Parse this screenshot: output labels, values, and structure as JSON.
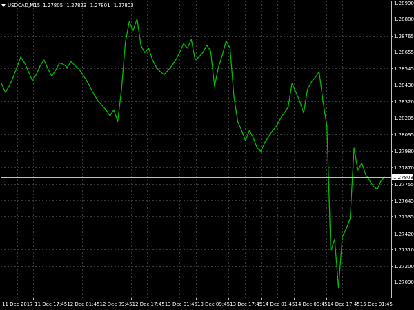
{
  "header": {
    "symbol": "USDCAD,M15",
    "ohlc": [
      "1.27805",
      "1.27823",
      "1.27801",
      "1.27803"
    ]
  },
  "current_price_label": "1.27803",
  "colors": {
    "background": "#000000",
    "grid": "#3a3a3a",
    "frame": "#c0c0c0",
    "series": "#00c000",
    "text": "#ffffff",
    "bid_line": "#c0c0c0",
    "price_tag_bg": "#ffffff",
    "price_tag_text": "#000000"
  },
  "chart_data": {
    "type": "line",
    "title": "USDCAD,M15",
    "xlabel": "",
    "ylabel": "",
    "ylim": [
      1.26983,
      1.29003
    ],
    "grid": true,
    "y_ticks": [
      "1.28990",
      "1.28880",
      "1.28765",
      "1.28655",
      "1.28545",
      "1.28430",
      "1.28320",
      "1.28205",
      "1.28095",
      "1.27980",
      "1.27870",
      "1.27755",
      "1.27645",
      "1.27535",
      "1.27420",
      "1.27310",
      "1.27200",
      "1.27090"
    ],
    "x_ticks": [
      "11 Dec 2017",
      "11 Dec 17:45",
      "12 Dec 01:45",
      "12 Dec 09:45",
      "12 Dec 17:45",
      "13 Dec 01:45",
      "13 Dec 09:45",
      "13 Dec 17:45",
      "14 Dec 01:45",
      "14 Dec 09:45",
      "14 Dec 17:45",
      "15 Dec 01:45"
    ],
    "current_price": 1.27803,
    "series": [
      {
        "values": [
          1.2844,
          1.2838,
          1.2842,
          1.2848,
          1.2855,
          1.2862,
          1.2858,
          1.2852,
          1.2846,
          1.285,
          1.2856,
          1.286,
          1.2854,
          1.2849,
          1.2853,
          1.2858,
          1.2857,
          1.2855,
          1.2859,
          1.2856,
          1.2854,
          1.285,
          1.2846,
          1.2841,
          1.2836,
          1.2832,
          1.2829,
          1.2826,
          1.2822,
          1.2826,
          1.2818,
          1.284,
          1.2872,
          1.2886,
          1.288,
          1.2888,
          1.287,
          1.2865,
          1.2868,
          1.286,
          1.2855,
          1.2852,
          1.285,
          1.2853,
          1.2856,
          1.286,
          1.2865,
          1.2871,
          1.2868,
          1.2874,
          1.286,
          1.2862,
          1.2865,
          1.287,
          1.2866,
          1.2842,
          1.2855,
          1.2863,
          1.2873,
          1.2868,
          1.2835,
          1.2818,
          1.2812,
          1.2805,
          1.2812,
          1.2807,
          1.28,
          1.2798,
          1.2804,
          1.2808,
          1.2812,
          1.2815,
          1.282,
          1.2824,
          1.2828,
          1.2844,
          1.2838,
          1.2832,
          1.2824,
          1.284,
          1.2845,
          1.2848,
          1.2852,
          1.2832,
          1.2815,
          1.273,
          1.2738,
          1.2705,
          1.274,
          1.2745,
          1.2752,
          1.28,
          1.2785,
          1.279,
          1.2782,
          1.2778,
          1.2774,
          1.2772,
          1.2778,
          1.27803
        ]
      }
    ]
  }
}
